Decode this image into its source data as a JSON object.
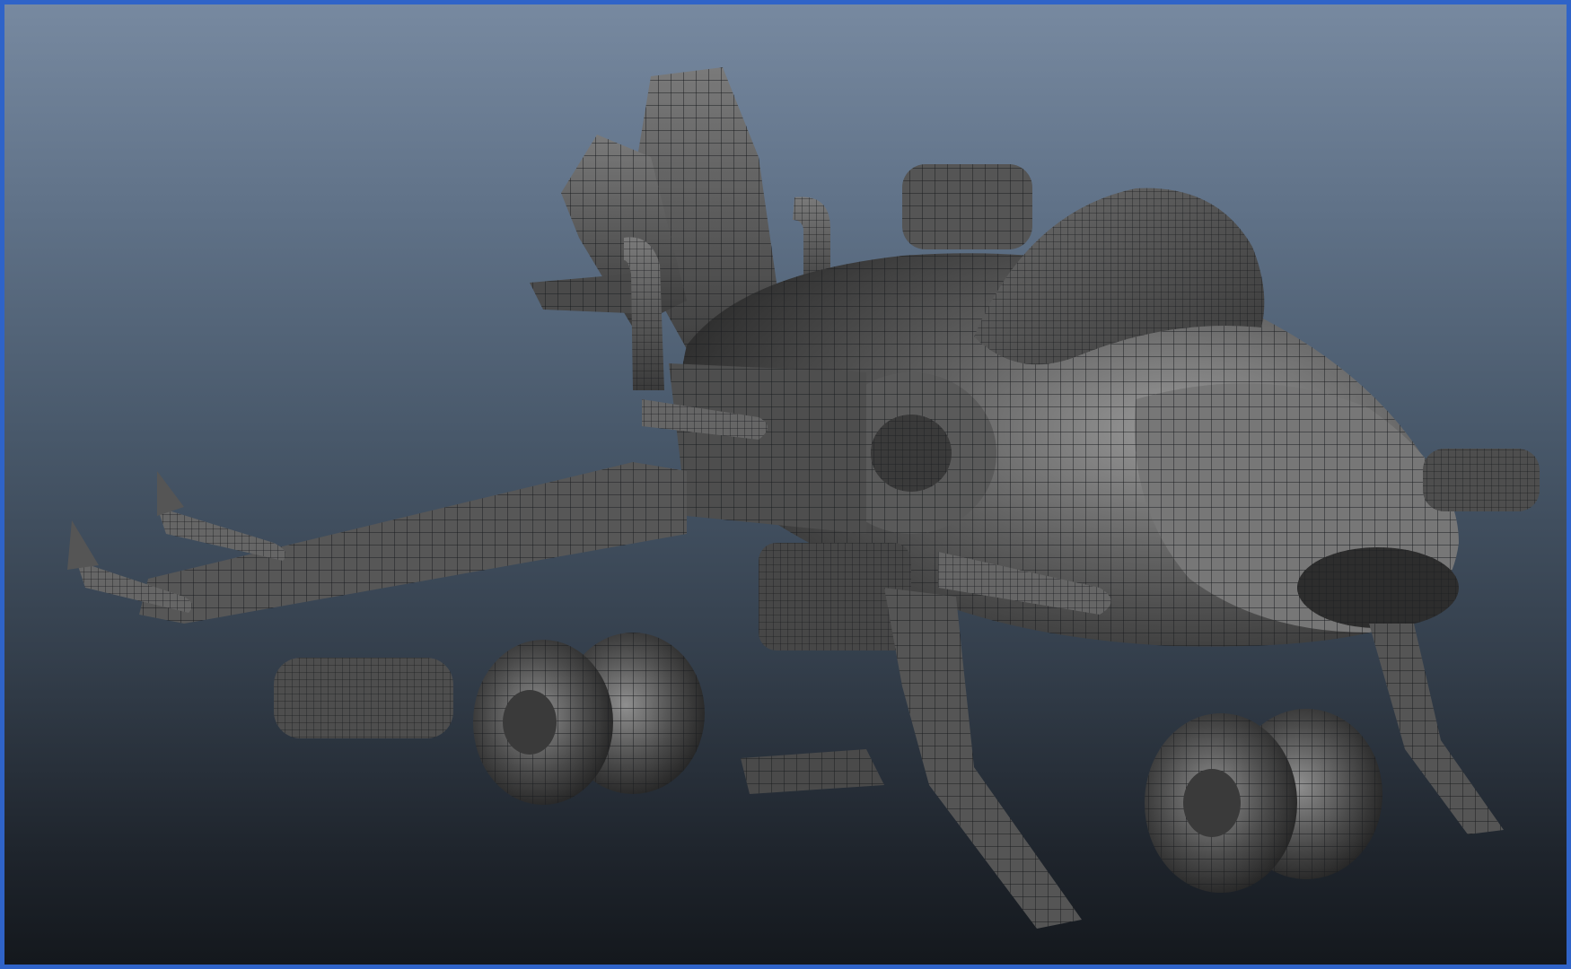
{
  "viewport": {
    "display_mode": "wireframe-on-shaded",
    "background_gradient": [
      "#7789a0",
      "#48586a",
      "#14181d"
    ],
    "frame_color": "#2f63c8"
  },
  "model": {
    "kind": "sci-fi wheeled gunship",
    "icon": "vehicle-mesh-icon"
  }
}
